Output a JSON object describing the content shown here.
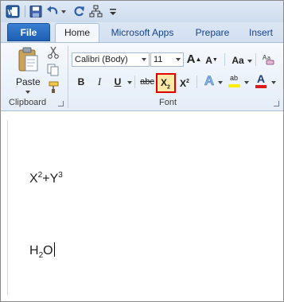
{
  "quick_access": {
    "app_icon": "word-icon",
    "items": [
      "save-icon",
      "undo-icon",
      "redo-icon",
      "structure-icon",
      "customize-icon"
    ]
  },
  "tabs": [
    {
      "label": "File",
      "active": false
    },
    {
      "label": "Home",
      "active": true
    },
    {
      "label": "Microsoft Apps",
      "active": false
    },
    {
      "label": "Prepare",
      "active": false
    },
    {
      "label": "Insert",
      "active": false
    }
  ],
  "clipboard": {
    "paste_label": "Paste",
    "group_label": "Clipboard"
  },
  "font": {
    "font_name": "Calibri (Body)",
    "font_size": "11",
    "group_label": "Font",
    "grow_label": "A",
    "shrink_label": "A",
    "case_label": "Aa",
    "bold_label": "B",
    "italic_label": "I",
    "underline_label": "U",
    "strike_label": "abc",
    "subscript_label": "X",
    "subscript_mark": "2",
    "superscript_label": "X",
    "superscript_mark": "2",
    "text_effects_label": "A",
    "highlight_label": "ab",
    "font_color_label": "A"
  },
  "colors": {
    "highlight_yellow": "#ffee00",
    "font_red": "#e01a1a",
    "selection_border": "#e00000"
  },
  "document": {
    "line1": {
      "base": "X",
      "sup1": "2",
      "mid": "+Y",
      "sup2": "3"
    },
    "line2": {
      "base": "H",
      "sub": "2",
      "tail": "O"
    }
  }
}
